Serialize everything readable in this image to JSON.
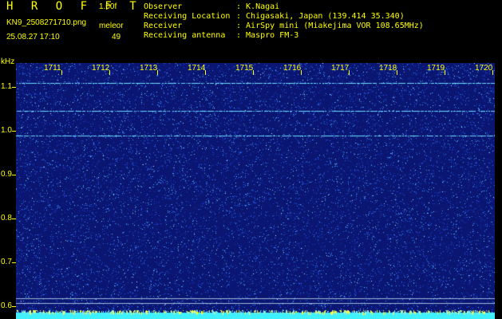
{
  "header": {
    "app_title": "H R O F F T",
    "version": "1.00f",
    "filename": "KN9_2508271710.png",
    "tag": "meleor",
    "timestamp": "25.08.27 17:10",
    "count": "49",
    "info_lines": [
      {
        "label": "Observer",
        "value": ": K.Nagai"
      },
      {
        "label": "Receiving Location",
        "value": ": Chigasaki, Japan (139.414 35.340)"
      },
      {
        "label": "Receiver",
        "value": ": AirSpy mini (Miakejima VOR 108.65MHz)"
      },
      {
        "label": "Receiving antenna",
        "value": ": Maspro FM-3"
      }
    ]
  },
  "y_axis": {
    "unit": "kHz",
    "ticks": [
      "1.1",
      "1.0",
      "0.9",
      "0.8",
      "0.7",
      "0.6"
    ],
    "range": [
      0.57,
      1.155
    ]
  },
  "x_axis": {
    "ticks": [
      "1711",
      "1712",
      "1713",
      "1714",
      "1715",
      "1716",
      "1717",
      "1718",
      "1719",
      "1720"
    ]
  },
  "spectrogram": {
    "background_color": "#0a1672",
    "noise_colors": [
      "#1d3cd0",
      "#2e6cf0",
      "#3aa0f0",
      "#6fd0ff",
      "#b8f0ff"
    ],
    "signal_color": "#6fe8ff",
    "signal_lines_khz": [
      1.11,
      1.045,
      0.99
    ],
    "reference_lines_khz": [
      0.617,
      0.607
    ]
  },
  "colors": {
    "accent": "#ffff00",
    "background": "#000000"
  }
}
